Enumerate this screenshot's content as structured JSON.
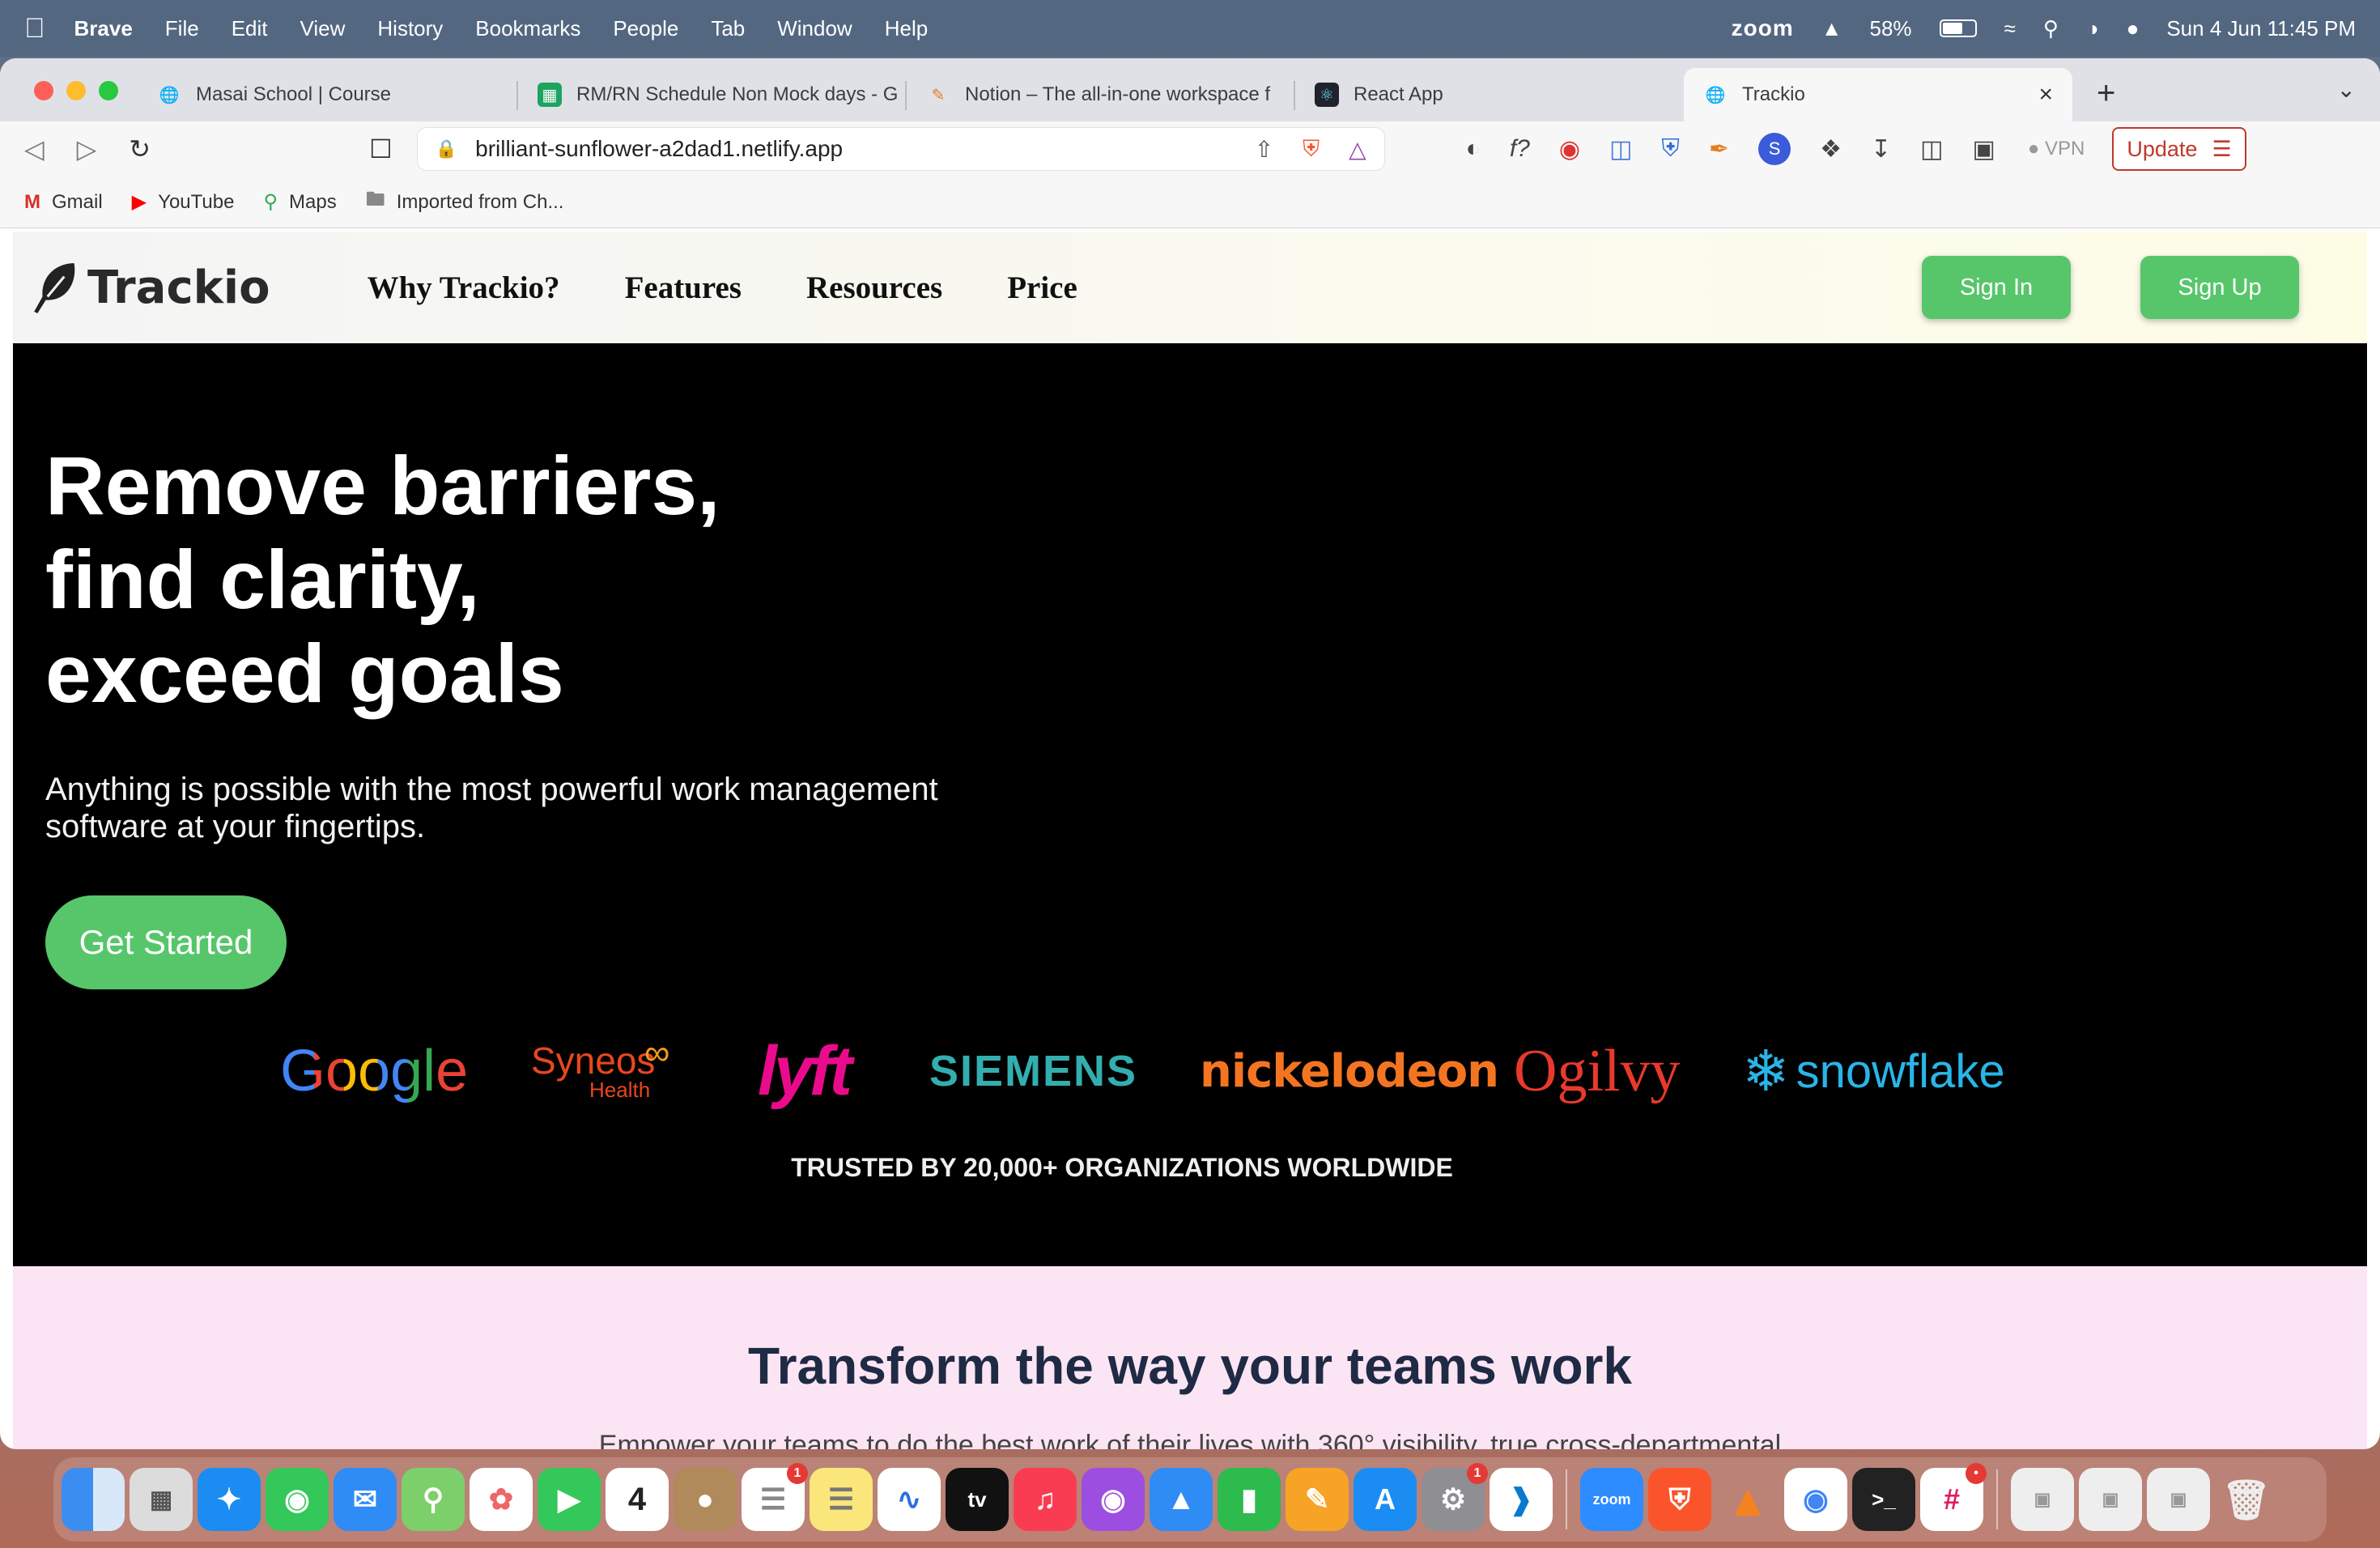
{
  "menubar": {
    "app": "Brave",
    "items": [
      "File",
      "Edit",
      "View",
      "History",
      "Bookmarks",
      "People",
      "Tab",
      "Window",
      "Help"
    ],
    "zoom": "zoom",
    "battery": "58%",
    "datetime": "Sun 4 Jun  11:45 PM"
  },
  "tabs": [
    {
      "title": "Masai School | Course",
      "icon": "globe-icon"
    },
    {
      "title": "RM/RN Schedule Non Mock days - G",
      "icon": "sheets-icon"
    },
    {
      "title": "Notion – The all-in-one workspace f",
      "icon": "notion-icon"
    },
    {
      "title": "React App",
      "icon": "react-icon"
    },
    {
      "title": "Trackio",
      "icon": "globe-icon"
    }
  ],
  "addressbar": {
    "url": "brilliant-sunflower-a2dad1.netlify.app",
    "vpn": "VPN",
    "update": "Update"
  },
  "bookmarks": [
    {
      "label": "Gmail",
      "icon": "gmail-icon"
    },
    {
      "label": "YouTube",
      "icon": "youtube-icon"
    },
    {
      "label": "Maps",
      "icon": "maps-icon"
    },
    {
      "label": "Imported from Ch...",
      "icon": "folder-icon"
    }
  ],
  "site": {
    "logo": "Trackio",
    "nav": [
      "Why Trackio?",
      "Features",
      "Resources",
      "Price"
    ],
    "signin": "Sign In",
    "signup": "Sign Up",
    "hero": {
      "line1": "Remove barriers,",
      "line2": "find clarity,",
      "line3": "exceed goals",
      "sub": "Anything is possible with the most powerful work management software at your fingertips.",
      "cta": "Get Started"
    },
    "brands": {
      "google": "Google",
      "syneos": "Syneos",
      "syneos_sub": "Health",
      "lyft": "lyft",
      "siemens": "SIEMENS",
      "nickelodeon": "nickelodeon",
      "ogilvy": "Ogilvy",
      "snowflake": "snowflake"
    },
    "trusted": "TRUSTED BY 20,000+ ORGANIZATIONS WORLDWIDE",
    "section2_title": "Transform the way your teams work",
    "section2_sub": "Empower your teams to do the best work of their lives with 360° visibility, true cross-departmental"
  },
  "colors": {
    "accent_green": "#57c66b",
    "hero_bg": "#000000",
    "section2_bg": "#fbe4f4"
  }
}
